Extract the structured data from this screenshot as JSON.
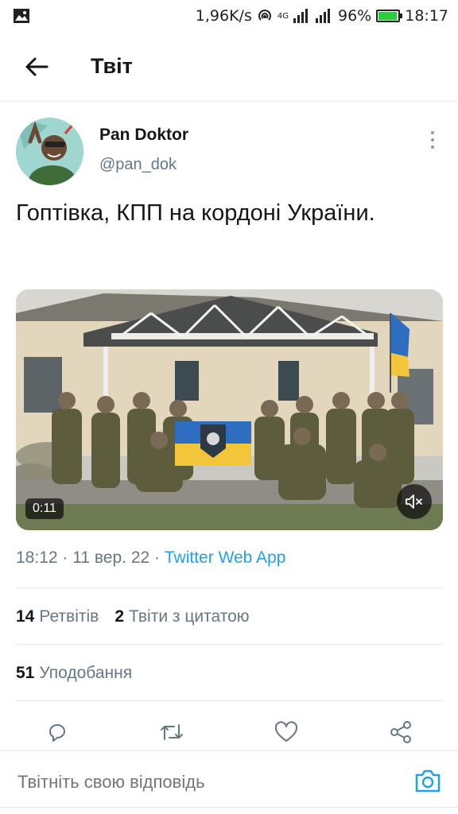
{
  "statusbar": {
    "speed": "1,96K/s",
    "network": "4G",
    "battery": "96%",
    "battery_level": 0.96,
    "time": "18:17"
  },
  "header": {
    "title": "Твіт"
  },
  "tweet": {
    "display_name": "Pan Doktor",
    "handle": "@pan_dok",
    "text": "Гоптівка, КПП на кордоні України.",
    "video_duration": "0:11",
    "time": "18:12",
    "date": "11 вер. 22",
    "sep": "·",
    "source": "Twitter Web App"
  },
  "stats": {
    "retweets_count": "14",
    "retweets_label": "Ретвітів",
    "quotes_count": "2",
    "quotes_label": "Твіти з цитатою",
    "likes_count": "51",
    "likes_label": "Уподобання"
  },
  "reply": {
    "placeholder": "Твітніть свою відповідь"
  },
  "colors": {
    "accent": "#1da1f2",
    "muted": "#657786",
    "divider": "#e1e8ed"
  },
  "icons": [
    "back-arrow-icon",
    "more-vertical-icon",
    "reply-icon",
    "retweet-icon",
    "like-icon",
    "share-icon",
    "camera-icon",
    "mute-icon",
    "image-icon"
  ]
}
